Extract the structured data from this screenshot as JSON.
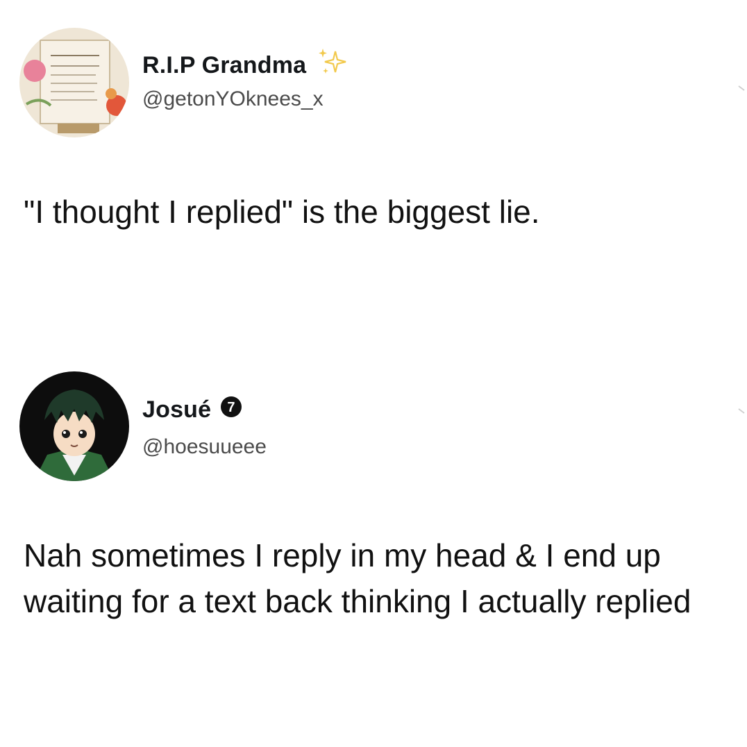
{
  "tweets": [
    {
      "display_name": "R.I.P Grandma",
      "handle": "@getonYOknees_x",
      "name_icon": "sparkle-icon",
      "text": "\"I thought I replied\" is the biggest lie."
    },
    {
      "display_name": "Josué",
      "handle": "@hoesuueee",
      "name_icon": "badge-icon",
      "badge_text": "7",
      "text": "Nah sometimes I reply in my head & I end up waiting for a text back thinking I actually replied"
    }
  ],
  "colors": {
    "text": "#14171a",
    "handle": "#4a4a4a",
    "background": "#ffffff",
    "sparkle": "#f2c94c"
  }
}
